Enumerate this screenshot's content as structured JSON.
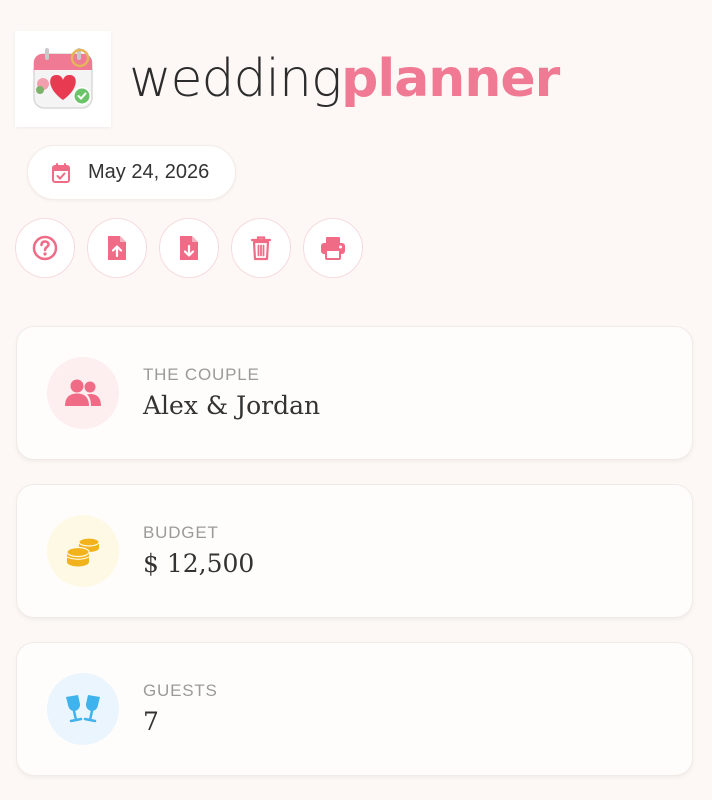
{
  "app": {
    "title_part1": "wedding",
    "title_part2": "planner",
    "logo_icon": "calendar-heart-icon"
  },
  "date": {
    "value": "May 24, 2026",
    "icon": "calendar-check-icon"
  },
  "toolbar": {
    "buttons": [
      {
        "name": "help",
        "icon": "question-circle-icon"
      },
      {
        "name": "upload",
        "icon": "file-upload-icon"
      },
      {
        "name": "download",
        "icon": "file-download-icon"
      },
      {
        "name": "delete",
        "icon": "trash-icon"
      },
      {
        "name": "print",
        "icon": "printer-icon"
      }
    ]
  },
  "cards": {
    "couple": {
      "label": "THE COUPLE",
      "value": "Alex & Jordan",
      "icon": "users-icon",
      "icon_color": "#f06b86",
      "bg": "#fdeef0"
    },
    "budget": {
      "label": "BUDGET",
      "value": "$ 12,500",
      "icon": "coins-icon",
      "icon_color": "#f2b21c",
      "bg": "#fef9e5"
    },
    "guests": {
      "label": "GUESTS",
      "value": "7",
      "icon": "champagne-glasses-icon",
      "icon_color": "#3fb3ee",
      "bg": "#eaf5fd"
    }
  },
  "colors": {
    "accent": "#f07a94",
    "background": "#fdf8f5"
  }
}
